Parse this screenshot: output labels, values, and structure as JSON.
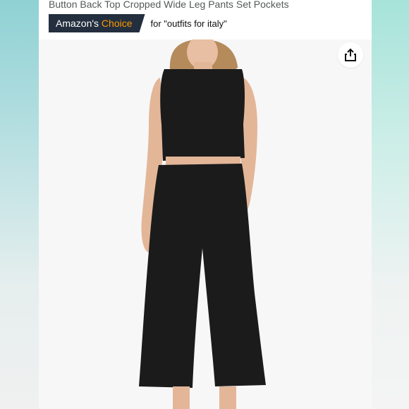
{
  "product": {
    "title": "Button Back Top Cropped Wide Leg Pants Set Pockets",
    "badge": {
      "prefix": "Amazon's",
      "highlight": "Choice"
    },
    "badge_context": "for \"outfits for italy\""
  },
  "share": {
    "icon": "share-icon"
  },
  "colors": {
    "badge_bg": "#232f3e",
    "badge_accent": "#ff9900",
    "outfit": "#1b1b1b"
  }
}
